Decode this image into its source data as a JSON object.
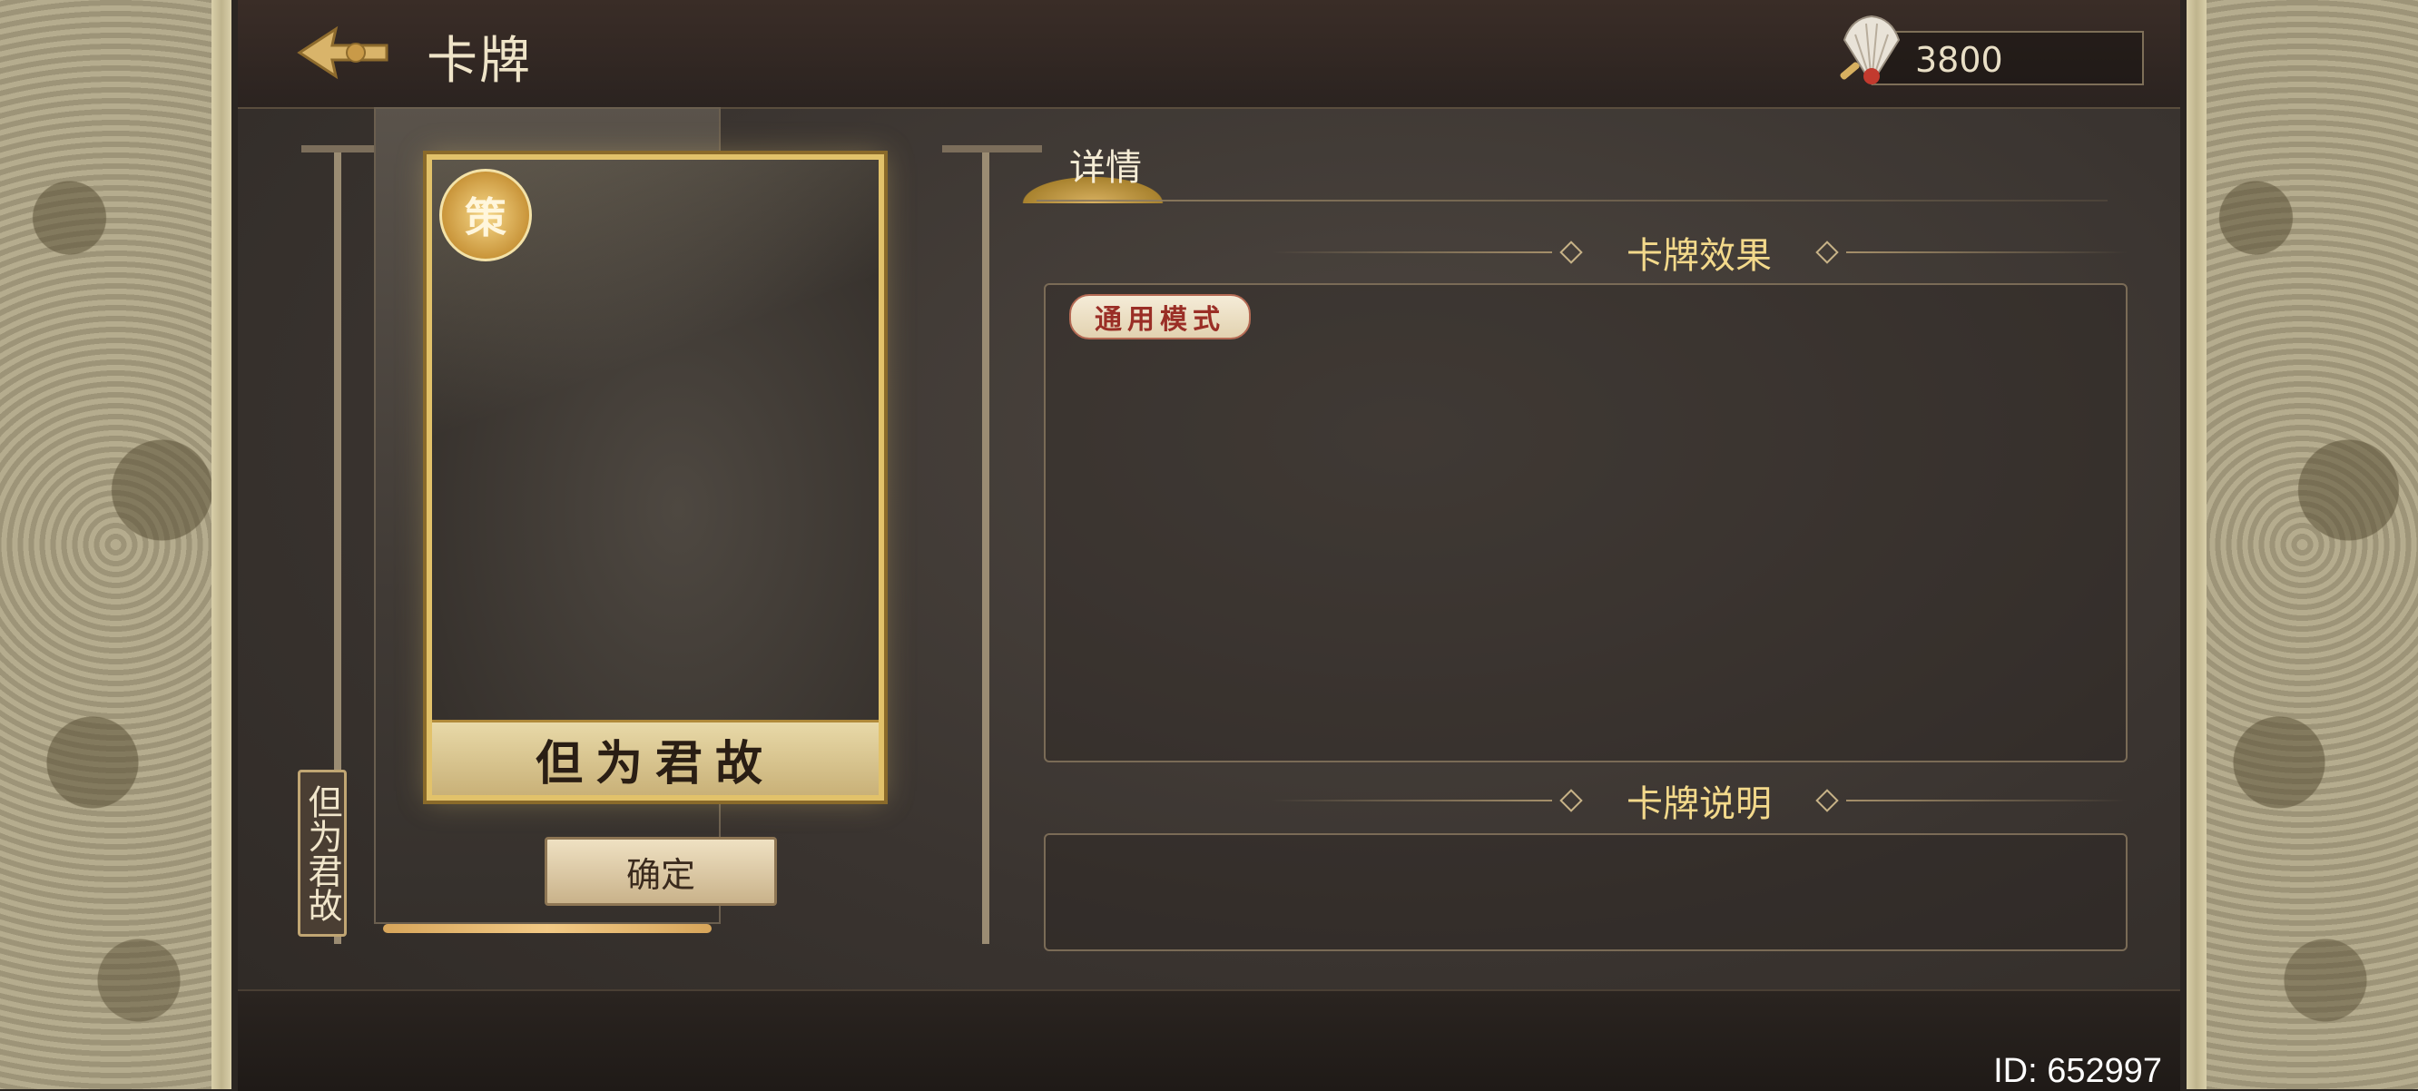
{
  "header": {
    "title": "卡牌",
    "currency_value": "3800",
    "back_icon": "back-arrow-icon",
    "currency_icon": "feather-fan-icon"
  },
  "card": {
    "name": "但为君故",
    "badge": "策",
    "vertical_label": "但为君故",
    "confirm_label": "确定"
  },
  "tabs": [
    {
      "label": "详情",
      "active": true
    }
  ],
  "sections": {
    "effect_title": "卡牌效果",
    "mode_tag": "通用模式",
    "description_title": "卡牌说明"
  },
  "footer": {
    "user_id": "ID: 652997"
  },
  "colors": {
    "accent_gold": "#f3d98b",
    "card_border": "#e2c26a",
    "tag_red": "#9a2e26"
  }
}
